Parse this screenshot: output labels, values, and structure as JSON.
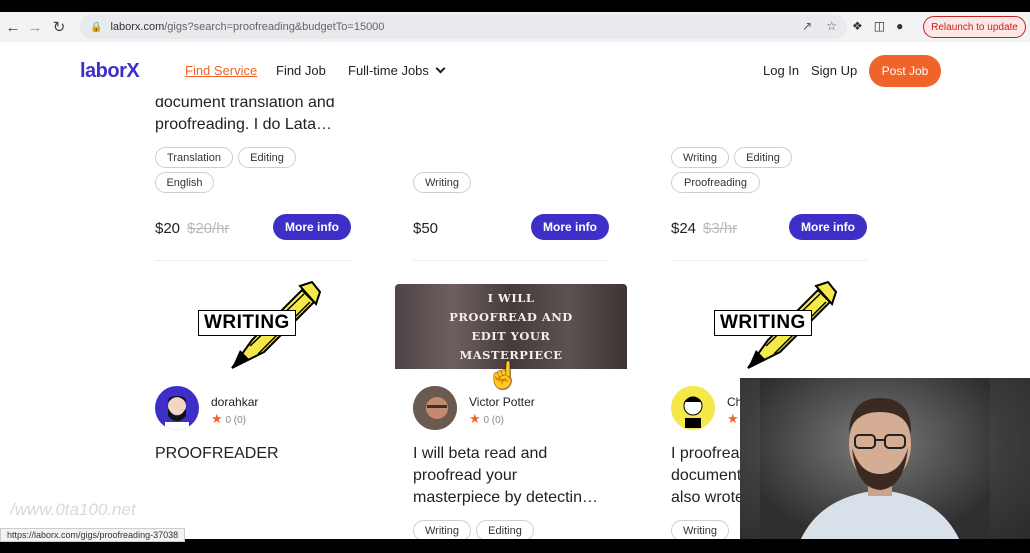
{
  "browser": {
    "url_domain": "laborx.com",
    "url_path": "/gigs?search=proofreading&budgetTo=15000",
    "relaunch_label": "Relaunch to update",
    "status_url": "https://laborx.com/gigs/proofreading-37038"
  },
  "header": {
    "logo": "laborX",
    "nav": [
      "Find Service",
      "Find Job",
      "Full-time Jobs"
    ],
    "login": "Log In",
    "signup": "Sign Up",
    "post_job": "Post Job"
  },
  "top_cards": [
    {
      "description_line1": "document translation and",
      "description_line2": "proofreading. I do Lata…",
      "tags": [
        "Translation",
        "Editing",
        "English"
      ],
      "price": "$20",
      "price_old": "$20/hr",
      "more_label": "More info"
    },
    {
      "tags": [
        "Writing"
      ],
      "price": "$50",
      "more_label": "More info"
    },
    {
      "tags": [
        "Writing",
        "Editing",
        "Proofreading"
      ],
      "price": "$24",
      "price_old": "$3/hr",
      "more_label": "More info"
    }
  ],
  "bottom_cards": [
    {
      "image_text": "WRITING",
      "user": "dorahkar",
      "rating": "0",
      "reviews": "(0)",
      "title_line1": "PROOFREADER"
    },
    {
      "image_text": "I WILL PROOFREAD AND EDIT YOUR MASTERPIECE",
      "image_lines": [
        "I WILL",
        "PROOFREAD AND",
        "EDIT YOUR",
        "MASTERPIECE"
      ],
      "user": "Victor Potter",
      "rating": "0",
      "reviews": "(0)",
      "title_line1": "I will beta read and",
      "title_line2": "proofread your",
      "title_line3": "masterpiece by detectin…",
      "tags": [
        "Writing",
        "Editing"
      ]
    },
    {
      "image_text": "WRITING",
      "user": "Ch",
      "title_line1": "I proofrea",
      "title_line2": "document",
      "title_line3": "also wrote",
      "tags": [
        "Writing"
      ]
    }
  ],
  "watermark": "/www.0ta100.net",
  "colors": {
    "brand": "#3d2fc8",
    "accent": "#f0632a"
  }
}
